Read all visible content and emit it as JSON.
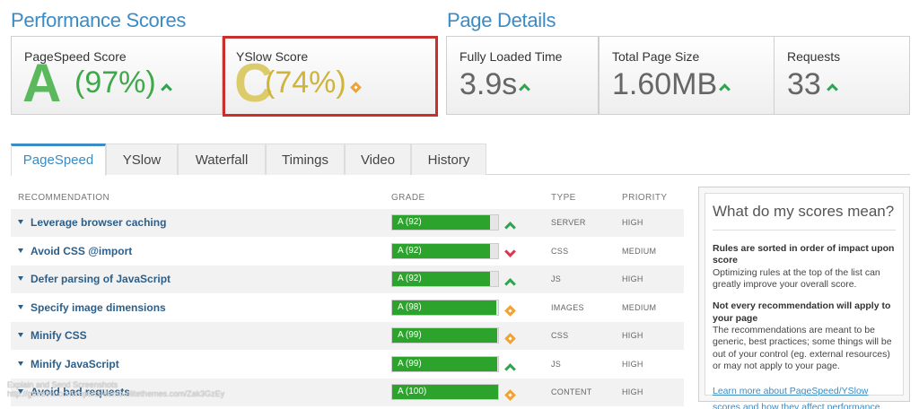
{
  "performance": {
    "title": "Performance Scores",
    "pagespeed": {
      "label": "PageSpeed Score",
      "grade": "A",
      "percent": "(97%)",
      "color": "#4caf50"
    },
    "yslow": {
      "label": "YSlow Score",
      "grade": "C",
      "percent": "(74%)",
      "color": "#d9c34a"
    }
  },
  "details": {
    "title": "Page Details",
    "load_time": {
      "label": "Fully Loaded Time",
      "value": "3.9s"
    },
    "page_size": {
      "label": "Total Page Size",
      "value": "1.60MB"
    },
    "requests": {
      "label": "Requests",
      "value": "33"
    }
  },
  "tabs": [
    "PageSpeed",
    "YSlow",
    "Waterfall",
    "Timings",
    "Video",
    "History"
  ],
  "table": {
    "headers": {
      "recommendation": "RECOMMENDATION",
      "grade": "GRADE",
      "type": "TYPE",
      "priority": "PRIORITY"
    },
    "rows": [
      {
        "name": "Leverage browser caching",
        "grade": "A (92)",
        "score": 92,
        "trend": "up",
        "type": "SERVER",
        "priority": "HIGH"
      },
      {
        "name": "Avoid CSS @import",
        "grade": "A (92)",
        "score": 92,
        "trend": "down",
        "type": "CSS",
        "priority": "MEDIUM"
      },
      {
        "name": "Defer parsing of JavaScript",
        "grade": "A (92)",
        "score": 92,
        "trend": "up",
        "type": "JS",
        "priority": "HIGH"
      },
      {
        "name": "Specify image dimensions",
        "grade": "A (98)",
        "score": 98,
        "trend": "same",
        "type": "IMAGES",
        "priority": "MEDIUM"
      },
      {
        "name": "Minify CSS",
        "grade": "A (99)",
        "score": 99,
        "trend": "same",
        "type": "CSS",
        "priority": "HIGH"
      },
      {
        "name": "Minify JavaScript",
        "grade": "A (99)",
        "score": 99,
        "trend": "up",
        "type": "JS",
        "priority": "HIGH"
      },
      {
        "name": "Avoid bad requests",
        "grade": "A (100)",
        "score": 100,
        "trend": "same",
        "type": "CONTENT",
        "priority": "HIGH"
      }
    ]
  },
  "sidebar": {
    "title": "What do my scores mean?",
    "p1_bold": "Rules are sorted in order of impact upon score",
    "p1_text": "Optimizing rules at the top of the list can greatly improve your overall score.",
    "p2_bold": "Not every recommendation will apply to your page",
    "p2_text": "The recommendations are meant to be generic, best practices; some things will be out of your control (eg. external resources) or may not apply to your page.",
    "link": "Learn more about PageSpeed/YSlow scores and how they affect performance."
  },
  "watermark": {
    "line1": "Explain and Send Screenshots",
    "line2": "http://gtmetrix.com/reports/demo.elitethemes.com/Zak3GzEy"
  }
}
